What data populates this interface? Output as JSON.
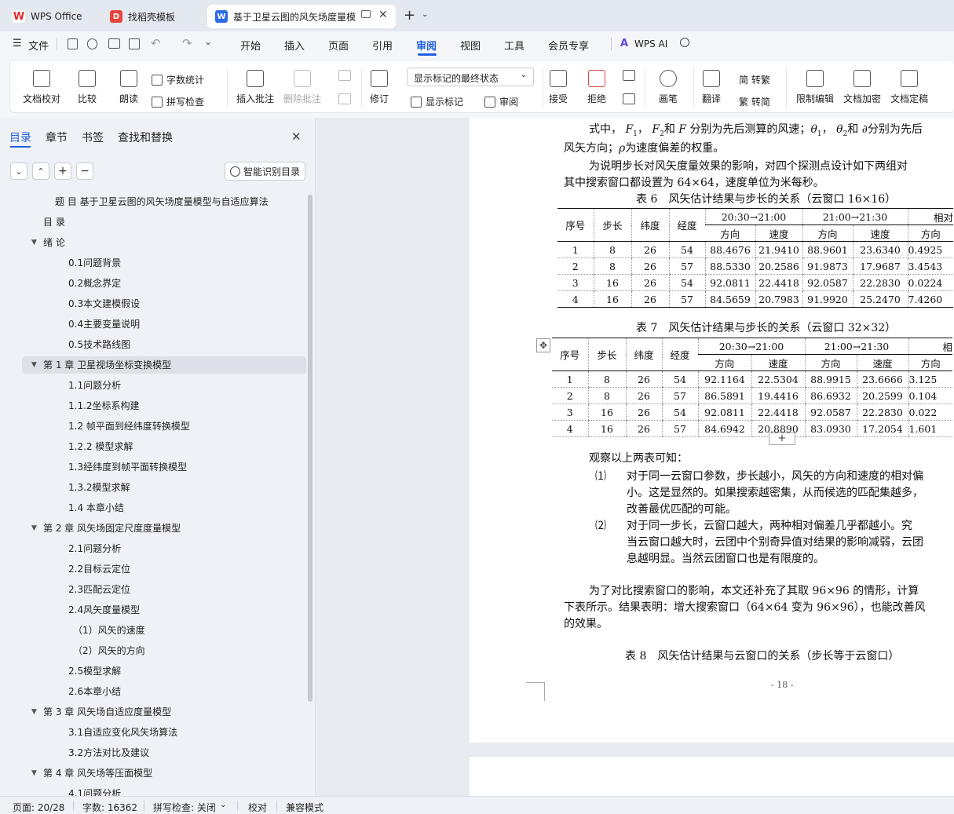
{
  "tabs": [
    {
      "label": "WPS Office"
    },
    {
      "label": "找稻壳模板"
    },
    {
      "label": "基于卫星云图的风矢场度量模"
    }
  ],
  "menu": {
    "file": "文件",
    "items": [
      "开始",
      "插入",
      "页面",
      "引用",
      "审阅",
      "视图",
      "工具",
      "会员专享"
    ],
    "active": "审阅",
    "ai": "WPS AI"
  },
  "ribbon": {
    "doc_check": "文档校对",
    "compare": "比较",
    "read_aloud": "朗读",
    "word_count": "字数统计",
    "spell_check": "拼写检查",
    "insert_comment": "插入批注",
    "delete_comment": "删除批注",
    "track_changes": "修订",
    "display_select": "显示标记的最终状态",
    "show_markup": "显示标记",
    "review": "审阅",
    "accept": "接受",
    "reject": "拒绝",
    "pen": "画笔",
    "translate": "翻译",
    "to_traditional": "简 转繁",
    "to_simplified": "繁 转简",
    "restrict": "限制编辑",
    "encrypt": "文档加密",
    "finalize": "文档定稿"
  },
  "panel": {
    "tabs": [
      "目录",
      "章节",
      "书签",
      "查找和替换"
    ],
    "active_tab": "目录",
    "smart_button": "智能识别目录",
    "toc": [
      {
        "text": "题 目 基于卫星云图的风矢场度量模型与自适应算法",
        "level": 0
      },
      {
        "text": "目 录",
        "level": 1
      },
      {
        "text": "绪 论",
        "level": 1,
        "arrow": true
      },
      {
        "text": "0.1问题背景",
        "level": 2
      },
      {
        "text": "0.2概念界定",
        "level": 2
      },
      {
        "text": "0.3本文建模假设",
        "level": 2
      },
      {
        "text": "0.4主要变量说明",
        "level": 2
      },
      {
        "text": "0.5技术路线图",
        "level": 2
      },
      {
        "text": "第 1 章 卫星视场坐标变换模型",
        "level": 1,
        "arrow": true,
        "selected": true
      },
      {
        "text": "1.1问题分析",
        "level": 2
      },
      {
        "text": "1.1.2坐标系构建",
        "level": 2
      },
      {
        "text": "1.2 帧平面到经纬度转换模型",
        "level": 2
      },
      {
        "text": "1.2.2 模型求解",
        "level": 2
      },
      {
        "text": "1.3经纬度到帧平面转换模型",
        "level": 2
      },
      {
        "text": "1.3.2模型求解",
        "level": 2
      },
      {
        "text": "1.4 本章小结",
        "level": 2
      },
      {
        "text": "第 2 章 风矢场固定尺度度量模型",
        "level": 1,
        "arrow": true
      },
      {
        "text": "2.1问题分析",
        "level": 2
      },
      {
        "text": "2.2目标云定位",
        "level": 2
      },
      {
        "text": "2.3匹配云定位",
        "level": 2
      },
      {
        "text": "2.4风矢度量模型",
        "level": 2
      },
      {
        "text": "（1）风矢的速度",
        "level": 3
      },
      {
        "text": "（2）风矢的方向",
        "level": 3
      },
      {
        "text": "2.5模型求解",
        "level": 2
      },
      {
        "text": "2.6本章小结",
        "level": 2
      },
      {
        "text": "第 3 章 风矢场自适应度量模型",
        "level": 1,
        "arrow": true
      },
      {
        "text": "3.1自适应变化风矢场算法",
        "level": 2
      },
      {
        "text": "3.2方法对比及建议",
        "level": 2
      },
      {
        "text": "第 4 章 风矢场等压面模型",
        "level": 1,
        "arrow": true
      },
      {
        "text": "4.1问题分析",
        "level": 2
      }
    ]
  },
  "doc": {
    "line1a": "式中，",
    "line1b": "分别为先后测算的风速；",
    "line1c": "分别为先后",
    "line2": "风矢方向；",
    "line2b": "为速度偏差的权重。",
    "line3": "为说明步长对风矢度量效果的影响，对四个探测点设计如下两组对",
    "line4": "其中搜索窗口都设置为 64×64，速度单位为米每秒。",
    "table6_title": "表 6　风矢估计结果与步长的关系（云窗口 16×16）",
    "table7_title": "表 7　风矢估计结果与步长的关系（云窗口 32×32）",
    "t6_head": [
      "序号",
      "步长",
      "纬度",
      "经度",
      "20:30→21:00",
      "21:00→21:30",
      "相对"
    ],
    "t7_head": [
      "序号",
      "步长",
      "纬度",
      "经度",
      "20:30→21:00",
      "21:00→21:30",
      "相"
    ],
    "sub_head": [
      "方向",
      "速度",
      "方向",
      "速度",
      "方向"
    ],
    "table6_rows": [
      [
        "1",
        "8",
        "26",
        "54",
        "88.4676",
        "21.9410",
        "88.9601",
        "23.6340",
        "0.4925"
      ],
      [
        "2",
        "8",
        "26",
        "57",
        "88.5330",
        "20.2586",
        "91.9873",
        "17.9687",
        "3.4543"
      ],
      [
        "3",
        "16",
        "26",
        "54",
        "92.0811",
        "22.4418",
        "92.0587",
        "22.2830",
        "0.0224"
      ],
      [
        "4",
        "16",
        "26",
        "57",
        "84.5659",
        "20.7983",
        "91.9920",
        "25.2470",
        "7.4260"
      ]
    ],
    "table7_rows": [
      [
        "1",
        "8",
        "26",
        "54",
        "92.1164",
        "22.5304",
        "88.9915",
        "23.6666",
        "3.125"
      ],
      [
        "2",
        "8",
        "26",
        "57",
        "86.5891",
        "19.4416",
        "86.6932",
        "20.2599",
        "0.104"
      ],
      [
        "3",
        "16",
        "26",
        "54",
        "92.0811",
        "22.4418",
        "92.0587",
        "22.2830",
        "0.022"
      ],
      [
        "4",
        "16",
        "26",
        "57",
        "84.6942",
        "20.8890",
        "83.0930",
        "17.2054",
        "1.601"
      ]
    ],
    "obs": "观察以上两表可知：",
    "p1_num": "⑴",
    "p1_l1": "对于同一云窗口参数，步长越小，风矢的方向和速度的相对偏",
    "p1_l2": "小。这是显然的。如果搜索越密集，从而候选的匹配集越多，",
    "p1_l3": "改善最优匹配的可能。",
    "p2_num": "⑵",
    "p2_l1": "对于同一步长，云窗口越大，两种相对偏差几乎都越小。究",
    "p2_l2": "当云窗口越大时，云团中个别奇异值对结果的影响减弱，云团",
    "p2_l3": "息越明显。当然云团窗口也是有限度的。",
    "p3_l1": "为了对比搜索窗口的影响，本文还补充了其取 96×96 的情形，计算",
    "p3_l2": "下表所示。结果表明：增大搜索窗口（64×64 变为 96×96），也能改善风",
    "p3_l3": "的效果。",
    "table8_title": "表 8　风矢估计结果与云窗口的关系（步长等于云窗口）",
    "page_num": "- 18 -"
  },
  "status": {
    "page": "页面: 20/28",
    "words": "字数: 16362",
    "spell": "拼写检查: 关闭",
    "proof": "校对",
    "compat": "兼容模式"
  }
}
